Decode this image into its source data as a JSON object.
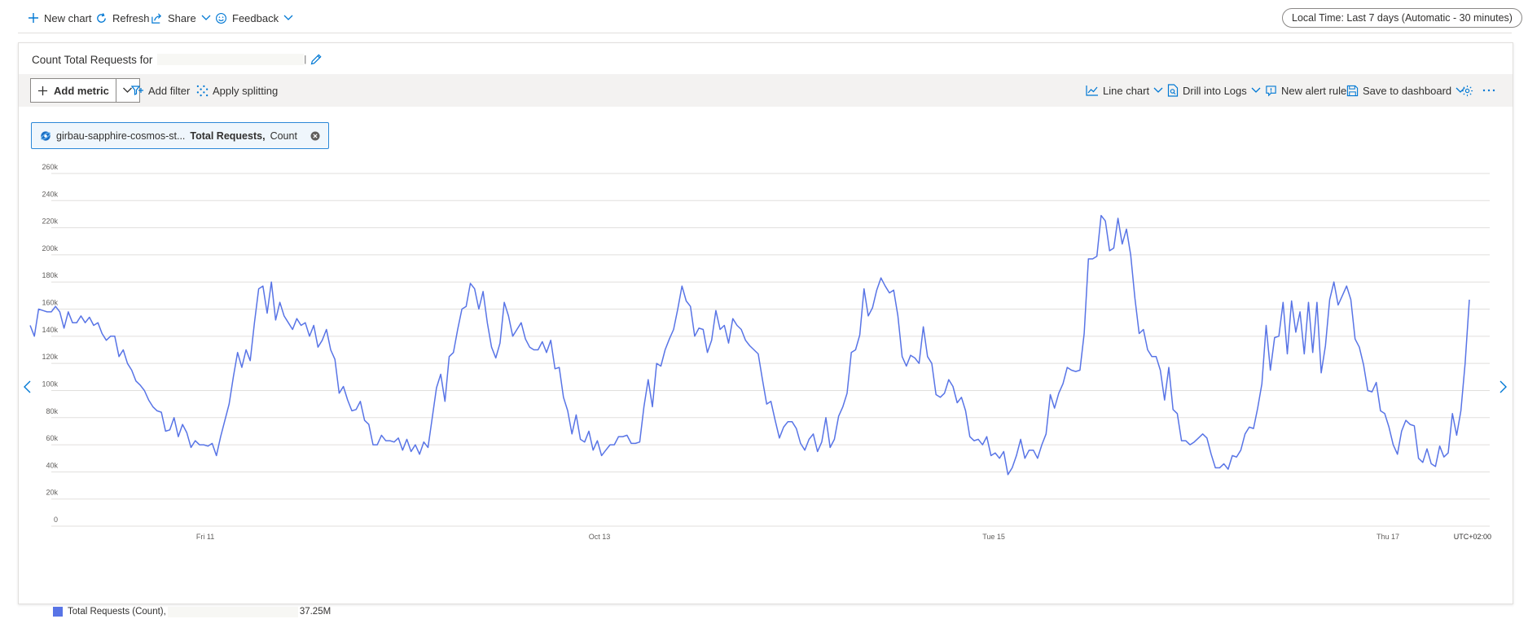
{
  "topbar": {
    "new_chart": "New chart",
    "refresh": "Refresh",
    "share": "Share",
    "feedback": "Feedback",
    "time_range": "Local Time: Last 7 days (Automatic - 30 minutes)"
  },
  "card": {
    "title": "Count Total Requests for",
    "title_suffix": "|"
  },
  "toolbar": {
    "add_metric": "Add metric",
    "add_filter": "Add filter",
    "apply_splitting": "Apply splitting",
    "line_chart": "Line chart",
    "drill_into_logs": "Drill into Logs",
    "new_alert_rule": "New alert rule",
    "save_to_dashboard": "Save to dashboard"
  },
  "metric_pill": {
    "resource": "girbau-sapphire-cosmos-st...",
    "metric": "Total Requests,",
    "aggregation": "Count"
  },
  "legend": {
    "label": "Total Requests (Count),",
    "total": "37.25M"
  },
  "colors": {
    "series": "#5874e6",
    "accent": "#0078d4",
    "grid": "#e1dfdd"
  },
  "chart_data": {
    "type": "line",
    "y_ticks": [
      "260k",
      "240k",
      "220k",
      "200k",
      "180k",
      "160k",
      "140k",
      "120k",
      "100k",
      "80k",
      "60k",
      "40k",
      "20k",
      "0"
    ],
    "y_tick_values": [
      260000,
      240000,
      220000,
      200000,
      180000,
      160000,
      140000,
      120000,
      100000,
      80000,
      60000,
      40000,
      20000,
      0
    ],
    "ylim": [
      0,
      260000
    ],
    "x_ticks": [
      {
        "label": "Fri 11",
        "t": 0.104
      },
      {
        "label": "Oct 13",
        "t": 0.379
      },
      {
        "label": "Tue 15",
        "t": 0.654
      },
      {
        "label": "Thu 17",
        "t": 0.929
      }
    ],
    "timezone": "UTC+02:00",
    "grid": true,
    "series": [
      {
        "name": "Total Requests (Count)",
        "values": [
          148000,
          140000,
          160000,
          159000,
          158000,
          158000,
          162000,
          158000,
          146000,
          158000,
          150000,
          150000,
          155000,
          150000,
          154000,
          148000,
          150000,
          142000,
          137000,
          140000,
          140000,
          125000,
          130000,
          120000,
          115000,
          107000,
          104000,
          100000,
          93000,
          88000,
          85000,
          84000,
          70000,
          71000,
          80000,
          66000,
          75000,
          69000,
          58000,
          63000,
          60000,
          60000,
          59000,
          61000,
          52000,
          66000,
          78000,
          90000,
          110000,
          128000,
          117000,
          130000,
          122000,
          150000,
          175000,
          177000,
          157000,
          180000,
          152000,
          165000,
          155000,
          150000,
          145000,
          153000,
          148000,
          150000,
          140000,
          148000,
          132000,
          137000,
          145000,
          130000,
          123000,
          98000,
          103000,
          93000,
          85000,
          86000,
          92000,
          78000,
          75000,
          60000,
          60000,
          67000,
          63000,
          63000,
          62000,
          65000,
          56000,
          64000,
          55000,
          60000,
          53000,
          62000,
          58000,
          80000,
          102000,
          112000,
          92000,
          125000,
          128000,
          145000,
          160000,
          162000,
          179000,
          175000,
          160000,
          173000,
          150000,
          132000,
          124000,
          135000,
          165000,
          155000,
          140000,
          145000,
          150000,
          138000,
          132000,
          130000,
          130000,
          136000,
          128000,
          137000,
          116000,
          117000,
          95000,
          85000,
          68000,
          82000,
          64000,
          62000,
          70000,
          56000,
          63000,
          52000,
          56000,
          60000,
          60000,
          66000,
          66000,
          67000,
          61000,
          61000,
          62000,
          88000,
          108000,
          88000,
          120000,
          118000,
          130000,
          138000,
          145000,
          160000,
          177000,
          166000,
          162000,
          140000,
          146000,
          145000,
          128000,
          137000,
          159000,
          145000,
          148000,
          135000,
          153000,
          148000,
          145000,
          137000,
          133000,
          130000,
          127000,
          108000,
          90000,
          92000,
          78000,
          65000,
          73000,
          77000,
          77000,
          72000,
          61000,
          56000,
          64000,
          68000,
          55000,
          62000,
          80000,
          58000,
          64000,
          81000,
          88000,
          98000,
          128000,
          130000,
          141000,
          175000,
          155000,
          161000,
          174000,
          183000,
          177000,
          172000,
          174000,
          155000,
          125000,
          118000,
          126000,
          124000,
          120000,
          147000,
          125000,
          120000,
          97000,
          95000,
          98000,
          108000,
          103000,
          91000,
          95000,
          85000,
          66000,
          63000,
          64000,
          60000,
          66000,
          52000,
          54000,
          50000,
          55000,
          38000,
          43000,
          52000,
          64000,
          50000,
          56000,
          56000,
          50000,
          60000,
          68000,
          97000,
          87000,
          98000,
          105000,
          117000,
          115000,
          114000,
          115000,
          142000,
          197000,
          197000,
          199000,
          229000,
          225000,
          203000,
          205000,
          227000,
          208000,
          219000,
          200000,
          168000,
          142000,
          145000,
          130000,
          125000,
          125000,
          115000,
          93000,
          117000,
          86000,
          83000,
          63000,
          63000,
          60000,
          62000,
          65000,
          68000,
          65000,
          53000,
          43000,
          43000,
          46000,
          42000,
          52000,
          51000,
          56000,
          68000,
          73000,
          72000,
          87000,
          105000,
          148000,
          115000,
          139000,
          140000,
          165000,
          127000,
          166000,
          143000,
          158000,
          127000,
          165000,
          128000,
          165000,
          113000,
          133000,
          167000,
          180000,
          163000,
          170000,
          177000,
          167000,
          138000,
          132000,
          119000,
          100000,
          99000,
          106000,
          85000,
          83000,
          73000,
          60000,
          53000,
          70000,
          78000,
          75000,
          74000,
          50000,
          47000,
          57000,
          46000,
          44000,
          59000,
          51000,
          54000,
          83000,
          67000,
          85000,
          120000,
          167000
        ]
      }
    ]
  }
}
